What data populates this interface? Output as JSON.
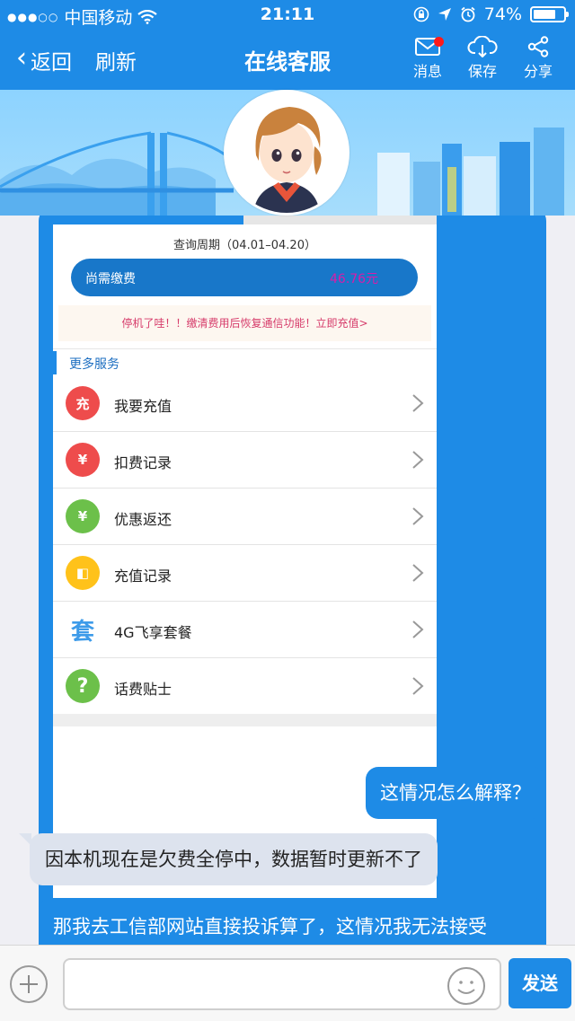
{
  "status_bar": {
    "signal_dots": "●●●○○",
    "carrier": "中国移动",
    "time": "21:11",
    "battery_pct": "74%",
    "battery_level": 0.74
  },
  "navbar": {
    "back_label": "返回",
    "refresh_label": "刷新",
    "title": "在线客服",
    "message_label": "消息",
    "save_label": "保存",
    "share_label": "分享",
    "has_unread": true
  },
  "card": {
    "period": "查询周期（04.01–04.20）",
    "due_label": "尚需缴费",
    "due_amount": "46.76元",
    "notice": "停机了哇！！缴清费用后恢复通信功能！立即充值>",
    "section_title": "更多服务",
    "items": [
      {
        "label": "我要充值",
        "icon_text": "充",
        "icon_color": "#ee4c4c"
      },
      {
        "label": "扣费记录",
        "icon_text": "¥",
        "icon_color": "#ee4c4c"
      },
      {
        "label": "优惠返还",
        "icon_text": "¥",
        "icon_color": "#6cc04a"
      },
      {
        "label": "充值记录",
        "icon_text": "◧",
        "icon_color": "#ffc21a"
      },
      {
        "label": "4G飞享套餐",
        "icon_text": "套",
        "icon_color": "#3d9be9"
      },
      {
        "label": "话费贴士",
        "icon_text": "?",
        "icon_color": "#6cc04a"
      }
    ]
  },
  "messages": {
    "user_1": "这情况怎么解释？",
    "agent_1": "因本机现在是欠费全停中，数据暂时更新不了",
    "user_2": "那我去工信部网站直接投诉算了，这情况我无法接受"
  },
  "input_bar": {
    "value": "",
    "send_label": "发送"
  },
  "colors": {
    "brand_blue": "#1e8be6",
    "page_bg": "#efeff4",
    "agent_bubble": "#dde3ee",
    "amount_magenta": "#d91ca9"
  }
}
